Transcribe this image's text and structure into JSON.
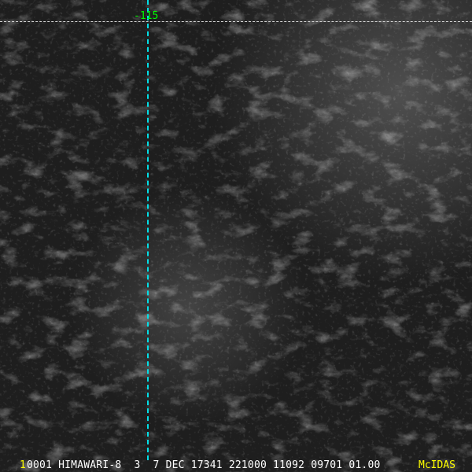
{
  "overlay": {
    "longitude_label": "-115",
    "frame_number": "1",
    "info_line": "0001 HIMAWARI-8  3  7 DEC 17341 221000 11092 09701 01.00",
    "logo": "McIDAS"
  },
  "colors": {
    "grid_line": "#d8d8d8",
    "meridian": "#00e0e8",
    "label_green": "#00ff00",
    "label_yellow": "#ffff00"
  }
}
